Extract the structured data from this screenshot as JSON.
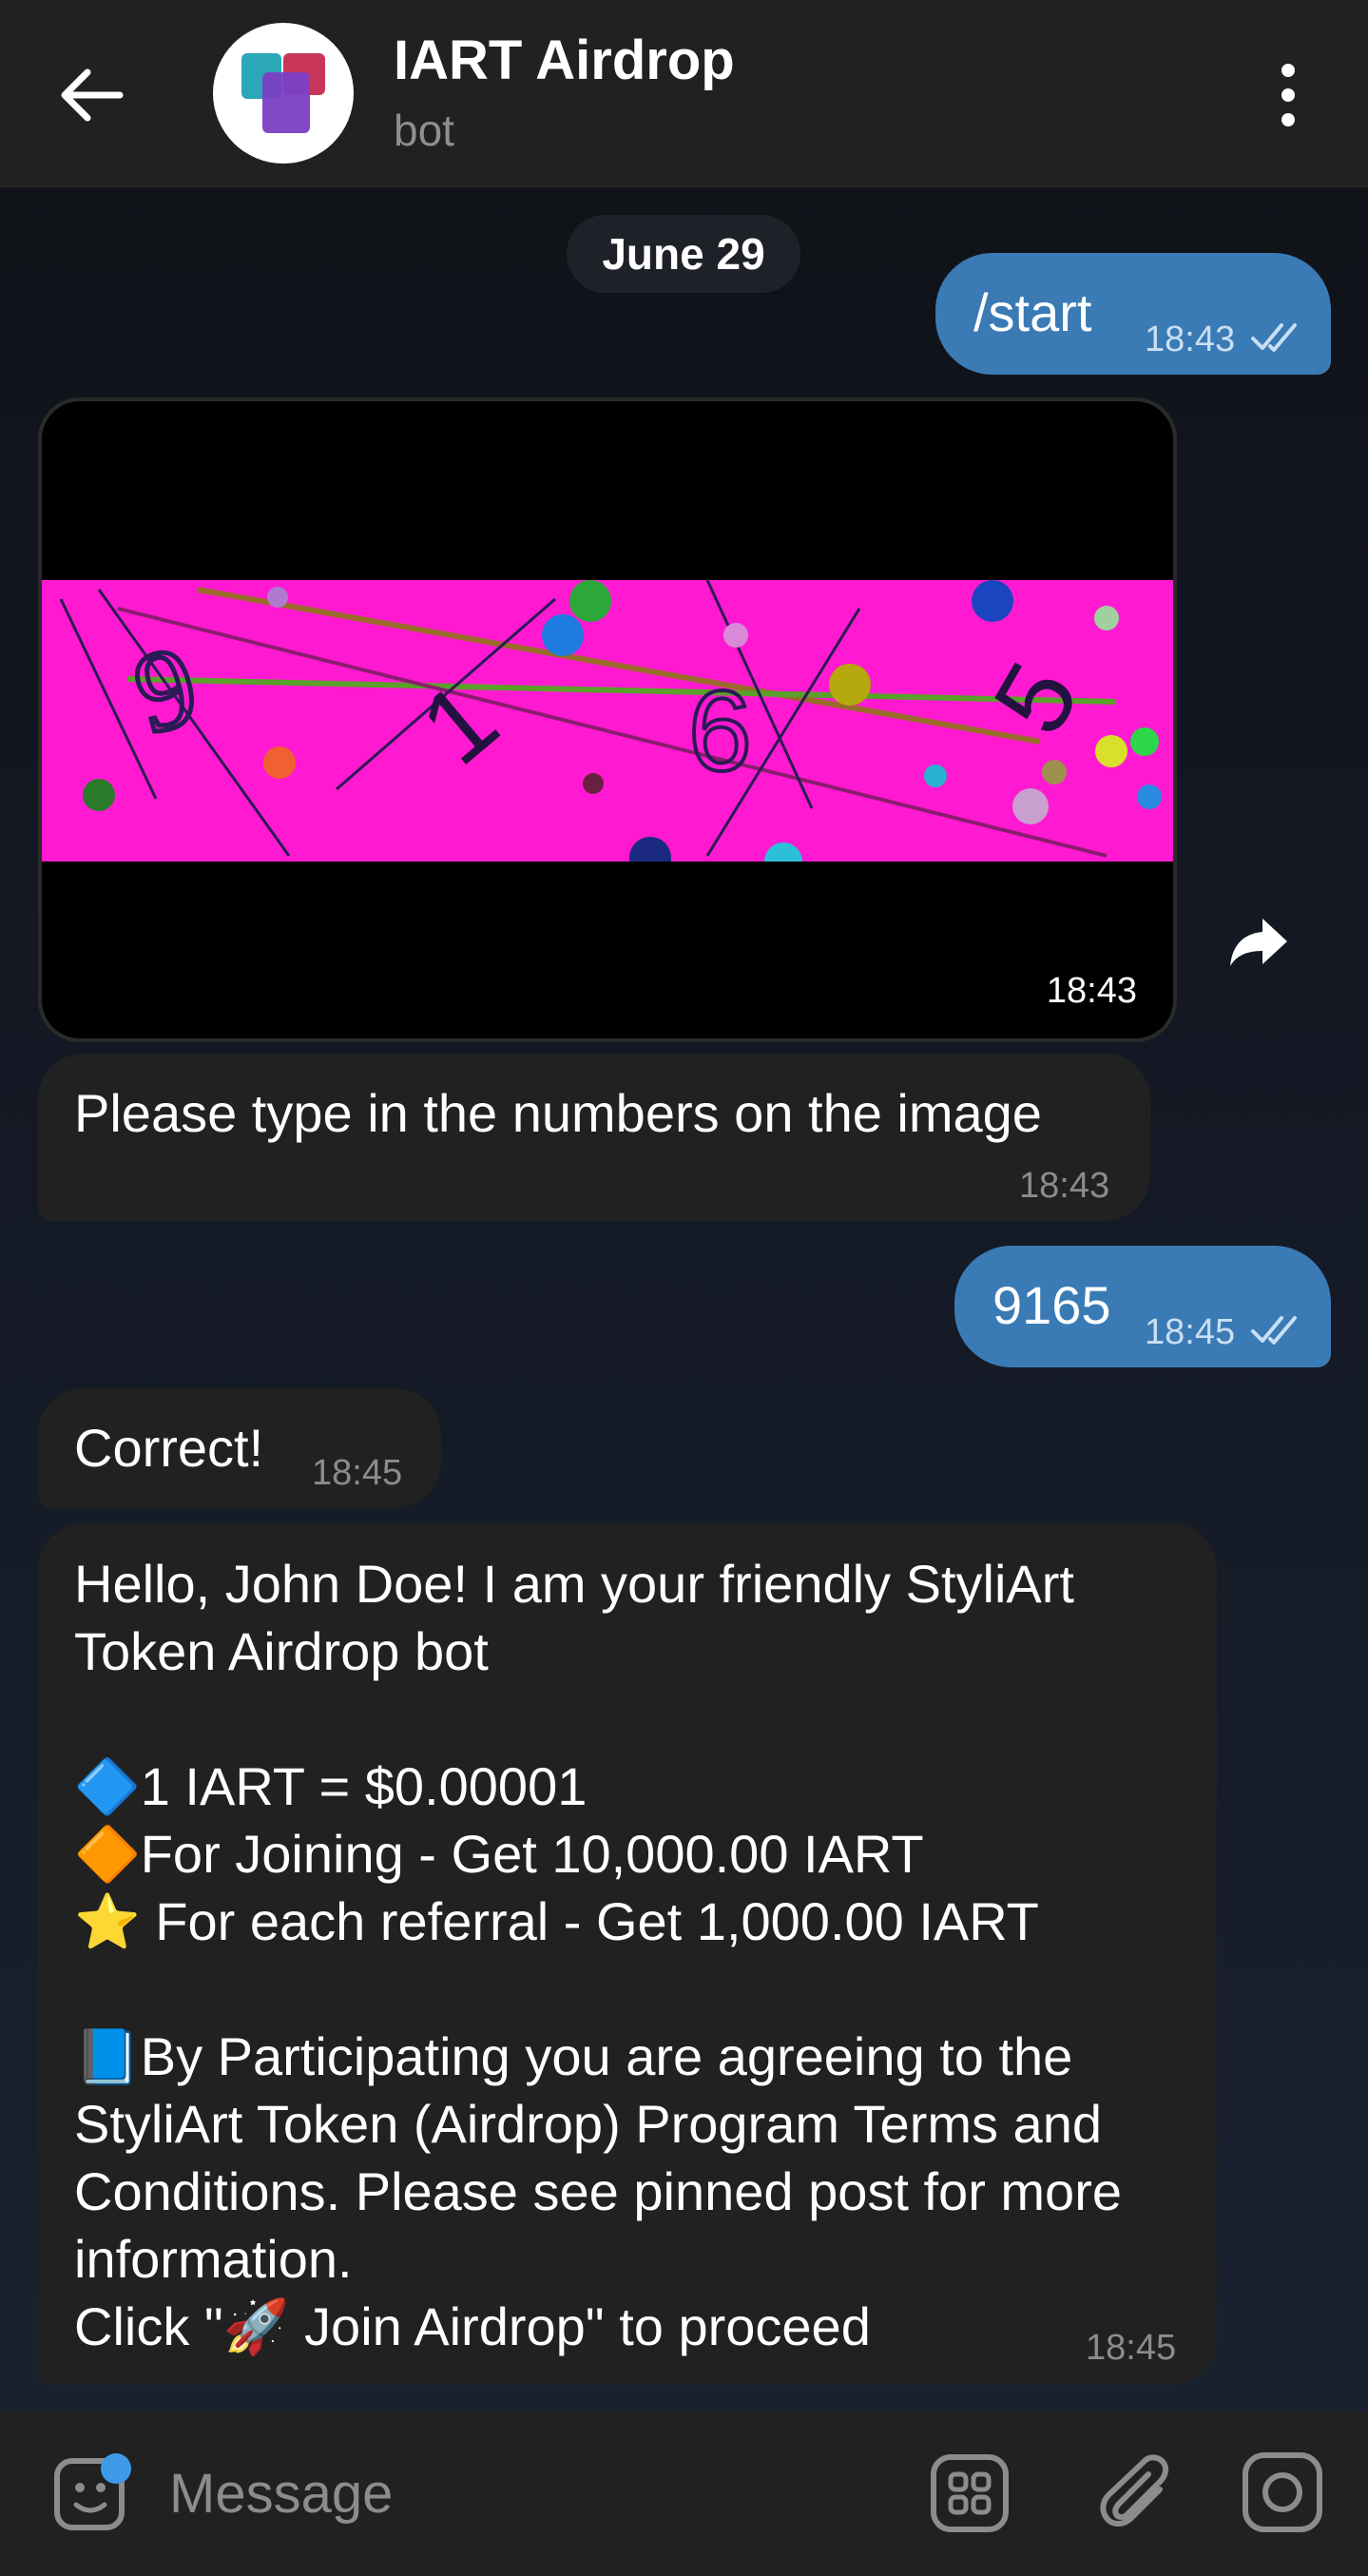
{
  "header": {
    "title": "IART Airdrop",
    "subtitle": "bot"
  },
  "date_separator": "June 29",
  "messages": [
    {
      "direction": "out",
      "text": "/start",
      "time": "18:43",
      "status": "read"
    },
    {
      "direction": "in",
      "type": "image",
      "time": "18:43"
    },
    {
      "direction": "in",
      "text": "Please type in the numbers on the image",
      "time": "18:43"
    },
    {
      "direction": "out",
      "text": "9165",
      "time": "18:45",
      "status": "read"
    },
    {
      "direction": "in",
      "text": "Correct!",
      "time": "18:45"
    },
    {
      "direction": "in",
      "time": "18:45",
      "text": "Hello, John Doe! I am your friendly StyliArt Token Airdrop bot\n\n🔷1 IART = $0.00001\n🔶For Joining - Get 10,000.00 IART\n⭐ For each referral - Get 1,000.00 IART\n\n📘By Participating you are agreeing to the StyliArt Token (Airdrop) Program Terms and Conditions. Please see pinned post for more information.\nClick \"🚀 Join Airdrop\" to proceed"
    }
  ],
  "composer": {
    "placeholder": "Message"
  },
  "colors": {
    "header_bg": "#212121",
    "outgoing_bubble": "#3a7ab5",
    "incoming_bubble": "#212121",
    "captcha_bg": "#ff1ad1",
    "accent_dot": "#3e9ae9"
  },
  "icons": [
    "back-arrow-icon",
    "bot-avatar-icon",
    "more-vert-icon",
    "read-ticks-icon",
    "share-icon",
    "sticker-emoji-icon",
    "bot-commands-icon",
    "paperclip-icon",
    "camera-icon"
  ]
}
